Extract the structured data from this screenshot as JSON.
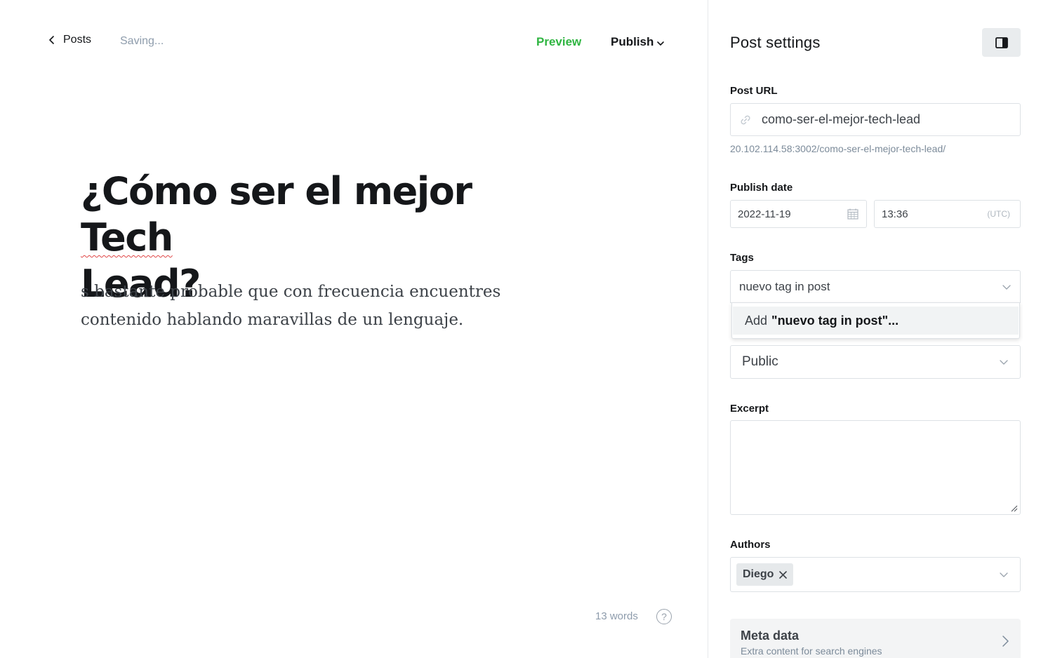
{
  "header": {
    "back_label": "Posts",
    "status": "Saving...",
    "preview_label": "Preview",
    "publish_label": "Publish"
  },
  "post": {
    "title_part1": "¿Cómo ser el mejor ",
    "title_part2": "Tech",
    "title_part3": "Lead?",
    "body": "s bastante probable que con frecuencia encuentres contenido hablando maravillas de un lenguaje."
  },
  "footer": {
    "word_count": "13 words",
    "help_symbol": "?"
  },
  "settings": {
    "title": "Post settings",
    "post_url": {
      "label": "Post URL",
      "value": "como-ser-el-mejor-tech-lead",
      "full_url": "20.102.114.58:3002/como-ser-el-mejor-tech-lead/"
    },
    "publish_date": {
      "label": "Publish date",
      "date": "2022-11-19",
      "time": "13:36",
      "timezone": "(UTC)"
    },
    "tags": {
      "label": "Tags",
      "input_value": "nuevo tag in post",
      "option_prefix": "Add",
      "option_value": "\"nuevo tag in post\"..."
    },
    "visibility": {
      "value": "Public"
    },
    "excerpt": {
      "label": "Excerpt",
      "value": ""
    },
    "authors": {
      "label": "Authors",
      "items": [
        "Diego"
      ]
    },
    "meta_data": {
      "title": "Meta data",
      "subtitle": "Extra content for search engines"
    }
  },
  "colors": {
    "accent_green": "#2fb541",
    "text_dark": "#15171a",
    "text_muted": "#8e9cac",
    "border": "#dde1e5",
    "spellcheck_red": "#e04646"
  },
  "icons": [
    "chevron-left-icon",
    "chevron-down-icon",
    "sidebar-toggle-icon",
    "link-icon",
    "calendar-icon",
    "close-icon",
    "chevron-right-icon",
    "help-icon"
  ]
}
